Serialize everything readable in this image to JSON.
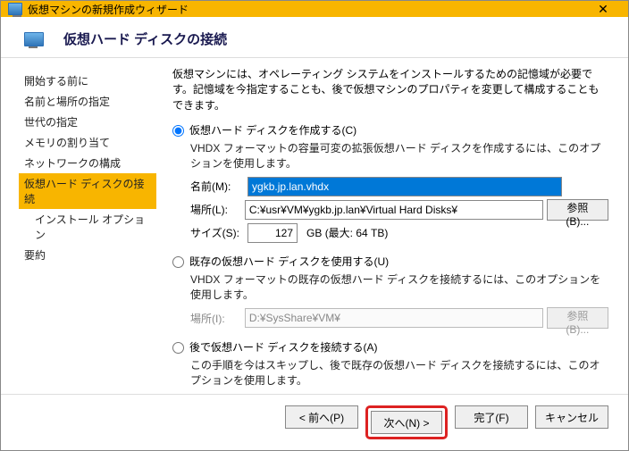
{
  "titlebar": {
    "title": "仮想マシンの新規作成ウィザード"
  },
  "header": {
    "title": "仮想ハード ディスクの接続"
  },
  "sidebar": {
    "items": [
      {
        "label": "開始する前に"
      },
      {
        "label": "名前と場所の指定"
      },
      {
        "label": "世代の指定"
      },
      {
        "label": "メモリの割り当て"
      },
      {
        "label": "ネットワークの構成"
      },
      {
        "label": "仮想ハード ディスクの接続"
      },
      {
        "label": "インストール オプション"
      },
      {
        "label": "要約"
      }
    ]
  },
  "main": {
    "description": "仮想マシンには、オペレーティング システムをインストールするための記憶域が必要です。記憶域を今指定することも、後で仮想マシンのプロパティを変更して構成することもできます。",
    "option_create": {
      "label": "仮想ハード ディスクを作成する(C)",
      "checked": true,
      "hint": "VHDX フォーマットの容量可変の拡張仮想ハード ディスクを作成するには、このオプションを使用します。",
      "fields": {
        "name_label": "名前(M):",
        "name_value": "ygkb.jp.lan.vhdx",
        "location_label": "場所(L):",
        "location_value": "C:¥usr¥VM¥ygkb.jp.lan¥Virtual Hard Disks¥",
        "browse_label": "参照(B)...",
        "size_label": "サイズ(S):",
        "size_value": "127",
        "size_suffix": "GB (最大: 64 TB)"
      }
    },
    "option_existing": {
      "label": "既存の仮想ハード ディスクを使用する(U)",
      "checked": false,
      "hint": "VHDX フォーマットの既存の仮想ハード ディスクを接続するには、このオプションを使用します。",
      "fields": {
        "location_label": "場所(I):",
        "location_value": "D:¥SysShare¥VM¥",
        "browse_label": "参照(B)..."
      }
    },
    "option_later": {
      "label": "後で仮想ハード ディスクを接続する(A)",
      "checked": false,
      "hint": "この手順を今はスキップし、後で既存の仮想ハード ディスクを接続するには、このオプションを使用します。"
    }
  },
  "footer": {
    "prev": "< 前へ(P)",
    "next": "次へ(N) >",
    "finish": "完了(F)",
    "cancel": "キャンセル"
  }
}
